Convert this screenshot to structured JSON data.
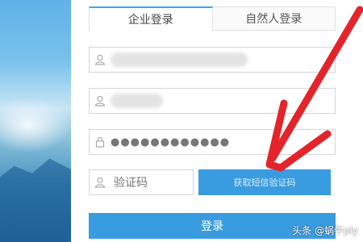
{
  "tabs": {
    "enterprise_login": "企业登录",
    "personal_login": "自然人登录"
  },
  "form": {
    "password_mask": "●●●●●●●●●●●●",
    "captcha_placeholder": "验证码",
    "sms_button": "获取短信验证码",
    "login_button": "登录"
  },
  "watermark": "头条 @蜗牛ply",
  "colors": {
    "accent": "#3a9ce0",
    "arrow": "#e5232a"
  }
}
